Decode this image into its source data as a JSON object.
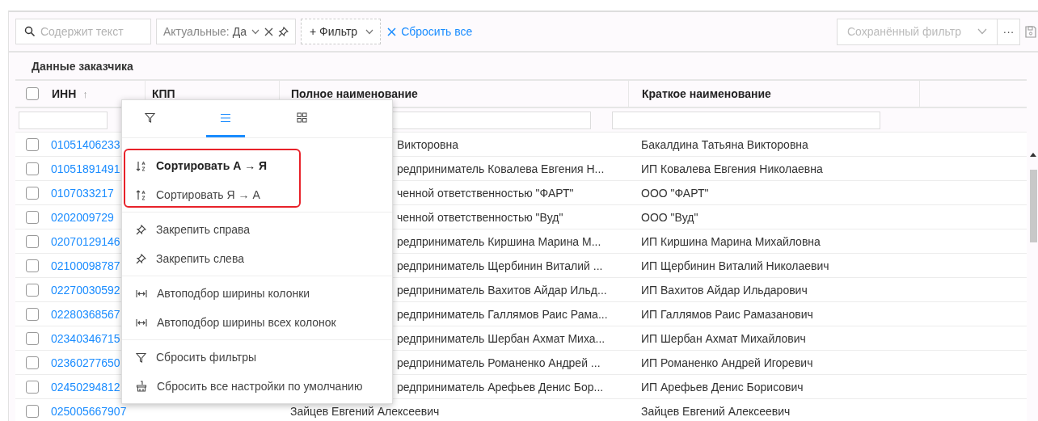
{
  "toolbar": {
    "search": {
      "placeholder": "Содержит текст"
    },
    "filter_chip": {
      "label": "Актуальные:",
      "value": "Да"
    },
    "add_filter": "+ Фильтр",
    "reset_all": "Сбросить все",
    "saved_filter": {
      "placeholder": "Сохранённый фильтр"
    },
    "more": "···"
  },
  "table": {
    "group_header": "Данные заказчика",
    "header_checkbox": {
      "checked": false
    },
    "columns": [
      {
        "label": "ИНН",
        "sort_arrow": "↑"
      },
      {
        "label": "КПП"
      },
      {
        "label": "Полное наименование"
      },
      {
        "label": "Краткое наименование"
      }
    ],
    "rows": [
      {
        "checked": false,
        "inn": "01051406233",
        "full_name": "Викторовна",
        "short_name": "Бакалдина Татьяна Викторовна"
      },
      {
        "checked": false,
        "inn": "01051891491",
        "full_name": "редприниматель Ковалева Евгения Н...",
        "short_name": "ИП Ковалева Евгения Николаевна"
      },
      {
        "checked": false,
        "inn": "0107033217",
        "full_name": "ченной ответственностью \"ФАРТ\"",
        "short_name": "ООО \"ФАРТ\""
      },
      {
        "checked": false,
        "inn": "0202009729",
        "full_name": "ченной ответственностью \"Вуд\"",
        "short_name": "ООО \"Вуд\""
      },
      {
        "checked": false,
        "inn": "02070129146",
        "full_name": "редприниматель Киршина Марина М...",
        "short_name": "ИП Киршина Марина Михайловна"
      },
      {
        "checked": false,
        "inn": "02100098787",
        "full_name": "редприниматель Щербинин Виталий ...",
        "short_name": "ИП Щербинин Виталий Николаевич"
      },
      {
        "checked": false,
        "inn": "02270030592",
        "full_name": "редприниматель Вахитов Айдар Ильд...",
        "short_name": "ИП Вахитов Айдар Ильдарович"
      },
      {
        "checked": false,
        "inn": "02280368567",
        "full_name": "редприниматель Галлямов Раис Рама...",
        "short_name": "ИП Галлямов Раис Рамазанович"
      },
      {
        "checked": false,
        "inn": "02340346715",
        "full_name": "редприниматель Шербан Ахмат Миха...",
        "short_name": "ИП Шербан Ахмат Михайлович"
      },
      {
        "checked": false,
        "inn": "02360277650",
        "full_name": "редприниматель Романенко Андрей ...",
        "short_name": "ИП Романенко Андрей Игоревич"
      },
      {
        "checked": false,
        "inn": "02450294812",
        "full_name": "редприниматель Арефьев Денис Бор...",
        "short_name": "ИП Арефьев Денис Борисович"
      },
      {
        "checked": false,
        "inn": "025005667907",
        "full_name": "Зайцев Евгений Алексеевич",
        "short_name": "Зайцев Евгений Алексеевич"
      }
    ]
  },
  "column_menu": {
    "tabs": [
      {
        "kind": "filter",
        "selected": false
      },
      {
        "kind": "list",
        "selected": true
      },
      {
        "kind": "grid",
        "selected": false
      }
    ],
    "groups": [
      {
        "highlighted": true,
        "items": [
          {
            "kind": "sortasc",
            "label": "Сортировать А → Я",
            "selected": true
          },
          {
            "kind": "sortdesc",
            "label": "Сортировать Я → А",
            "selected": false
          }
        ]
      },
      {
        "highlighted": false,
        "items": [
          {
            "kind": "pin",
            "label": "Закрепить справа"
          },
          {
            "kind": "pin",
            "label": "Закрепить слева"
          }
        ]
      },
      {
        "highlighted": false,
        "items": [
          {
            "kind": "autofit",
            "label": "Автоподбор ширины колонки"
          },
          {
            "kind": "autofit",
            "label": "Автоподбор ширины всех колонок"
          }
        ]
      },
      {
        "highlighted": false,
        "items": [
          {
            "kind": "filter",
            "label": "Сбросить фильтры"
          },
          {
            "kind": "reset",
            "label": "Сбросить все настройки по умолчанию"
          }
        ]
      }
    ]
  }
}
